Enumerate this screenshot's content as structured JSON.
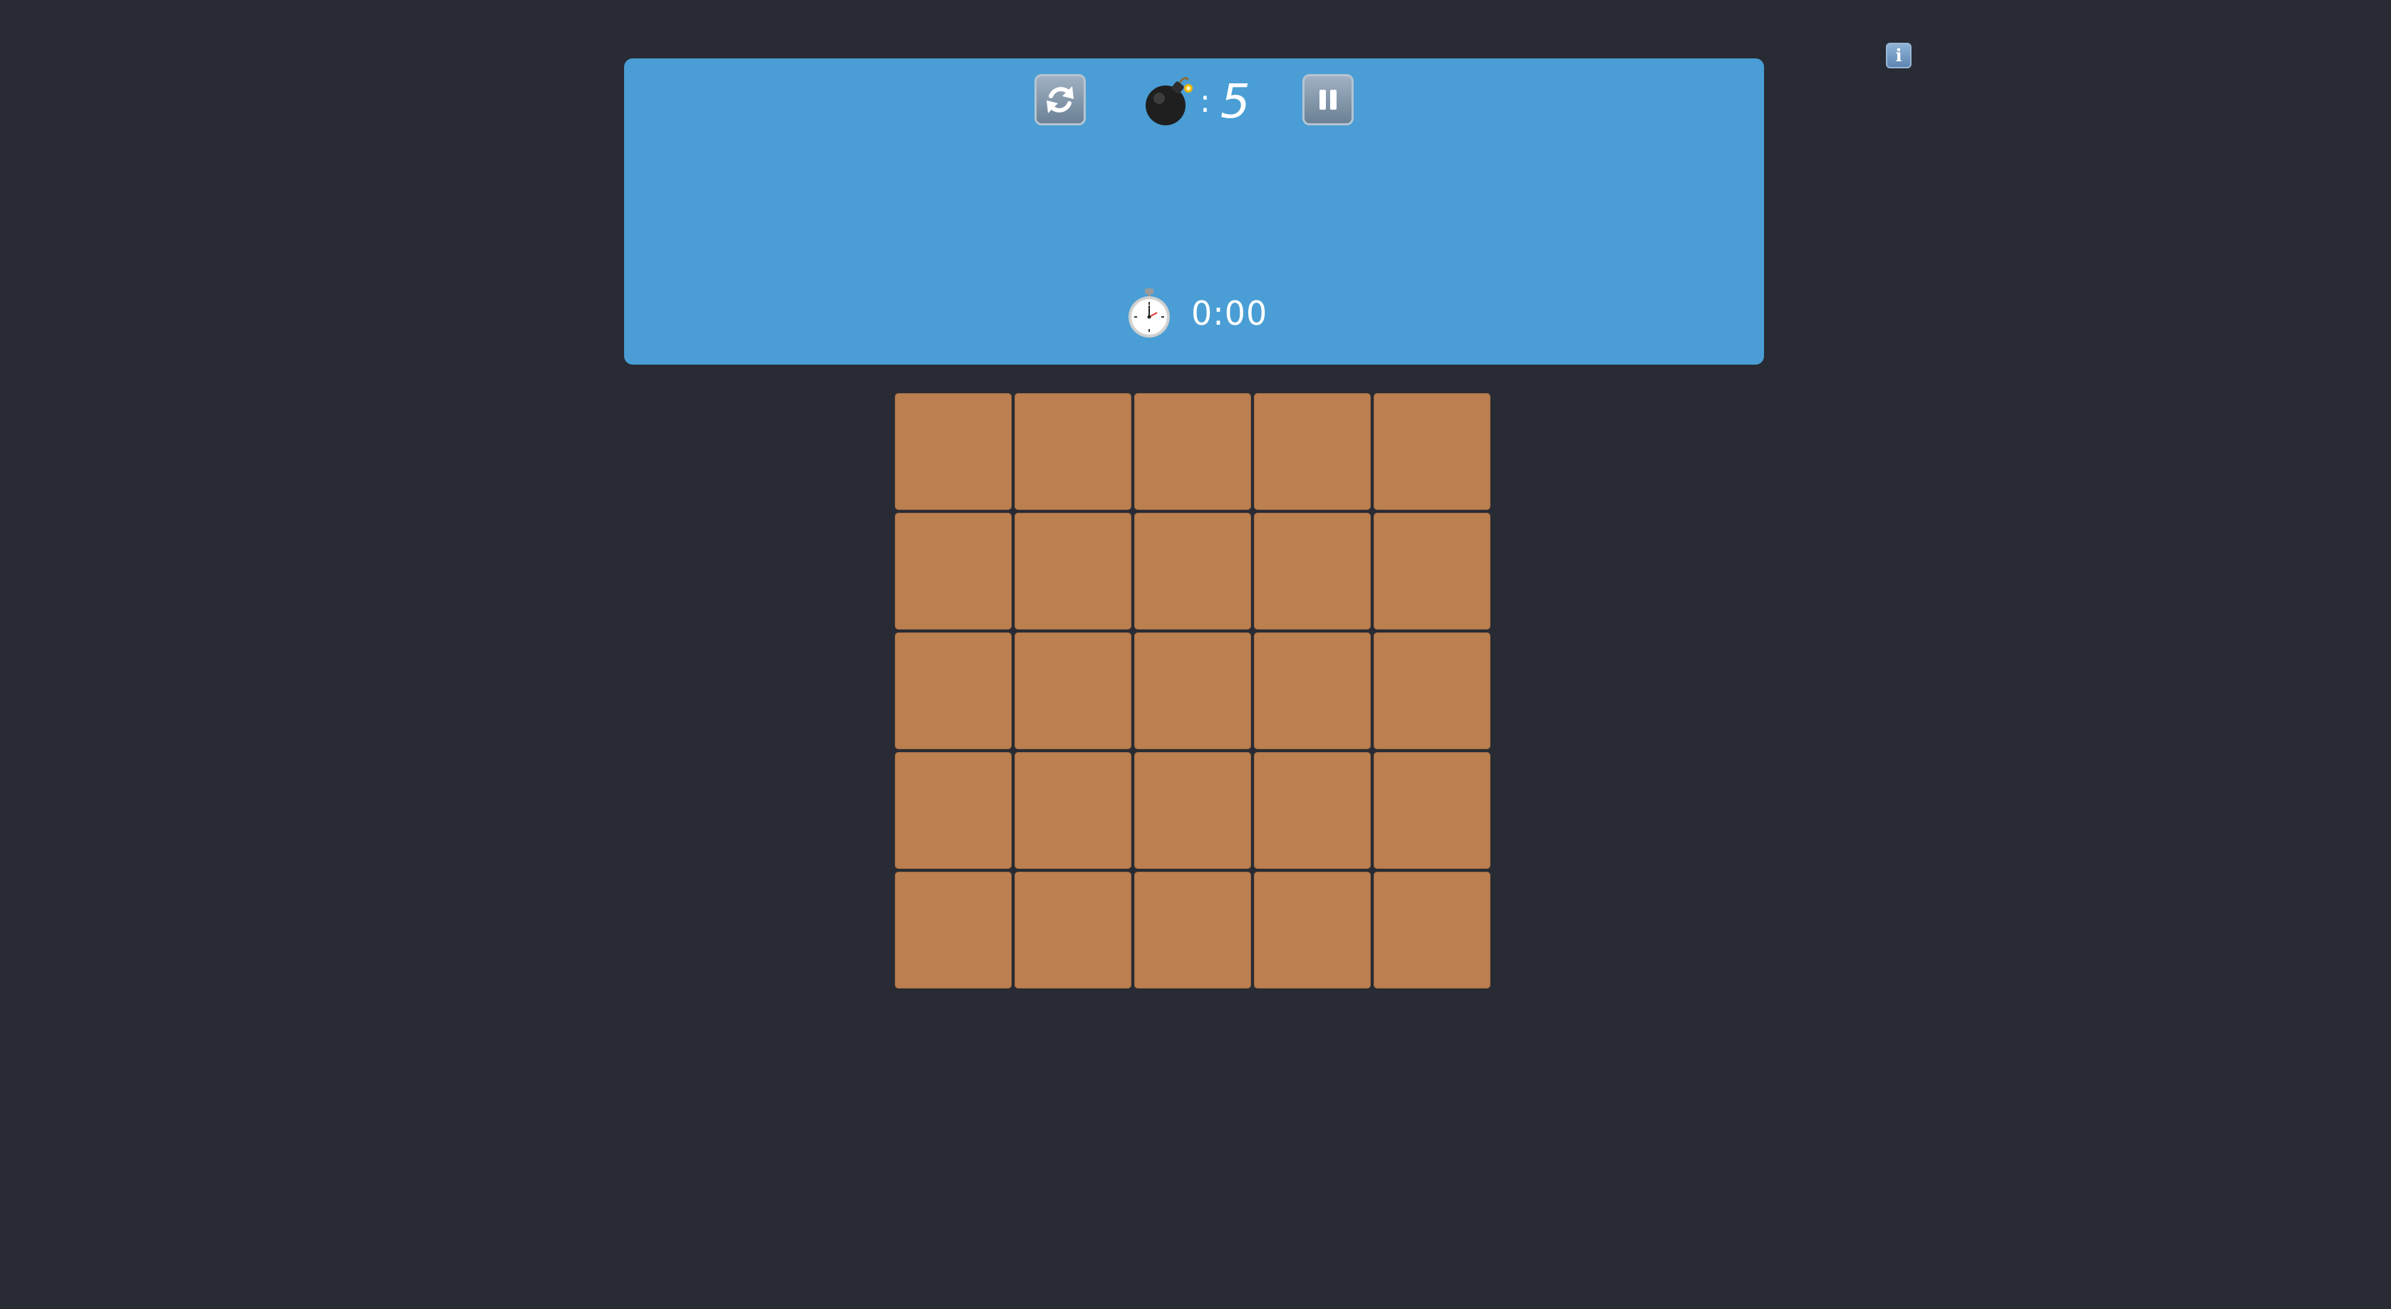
{
  "header": {
    "mine_counter": {
      "label": ":",
      "value": "5",
      "icon": "bomb-icon"
    },
    "restart_button": {
      "icon": "restart-icon"
    },
    "pause_button": {
      "icon": "pause-icon"
    },
    "timer": {
      "icon": "stopwatch-icon",
      "value": "0:00"
    }
  },
  "info_button": {
    "label": "i",
    "icon": "info-icon"
  },
  "board": {
    "rows": 5,
    "cols": 5,
    "cell_state": "unrevealed",
    "cell_color": "#bb7f50"
  },
  "colors": {
    "background": "#282b33",
    "header_panel": "#4a9ed5",
    "cell": "#bb7f50"
  }
}
